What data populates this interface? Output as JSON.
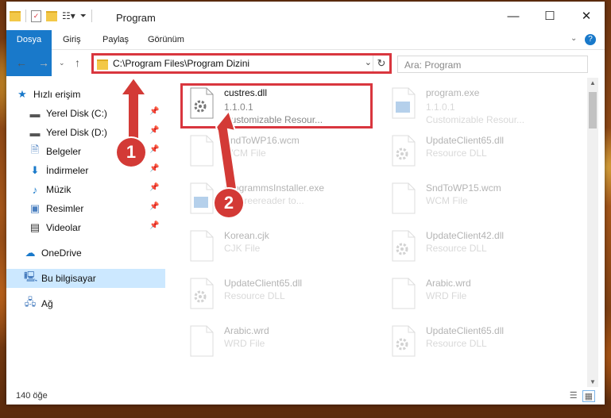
{
  "window": {
    "title": "Program",
    "min_icon": "minimize-icon",
    "max_icon": "maximize-icon",
    "close_icon": "close-icon"
  },
  "ribbon": {
    "tabs": [
      "Dosya",
      "Giriş",
      "Paylaş",
      "Görünüm"
    ],
    "accent": "#1979ca"
  },
  "address": {
    "path": "C:\\Program Files\\Program Dizini",
    "search_placeholder": "Ara: Program"
  },
  "nav": {
    "items": [
      {
        "label": "Hızlı erişim",
        "icon": "star-icon",
        "pinned": false
      },
      {
        "label": "Yerel Disk (C:)",
        "icon": "drive-icon",
        "pinned": true
      },
      {
        "label": "Yerel Disk (D:)",
        "icon": "drive-icon",
        "pinned": true
      },
      {
        "label": "Belgeler",
        "icon": "documents-icon",
        "pinned": true
      },
      {
        "label": "İndirmeler",
        "icon": "download-icon",
        "pinned": true
      },
      {
        "label": "Müzik",
        "icon": "music-icon",
        "pinned": true
      },
      {
        "label": "Resimler",
        "icon": "pictures-icon",
        "pinned": true
      },
      {
        "label": "Videolar",
        "icon": "video-icon",
        "pinned": true
      },
      {
        "label": "OneDrive",
        "icon": "cloud-icon",
        "pinned": false
      },
      {
        "label": "Bu bilgisayar",
        "icon": "computer-icon",
        "pinned": false
      },
      {
        "label": "Ağ",
        "icon": "network-icon",
        "pinned": false
      }
    ]
  },
  "files": [
    {
      "name": "custres.dll",
      "version": "1.1.0.1",
      "type": "Customizable Resour..."
    },
    {
      "name": "program.exe",
      "version": "1.1.0.1",
      "type": "Customizable Resour..."
    },
    {
      "name": "SndToWP16.wcm",
      "version": "",
      "type": "WCM File"
    },
    {
      "name": "UpdateClient65.dll",
      "version": "",
      "type": "Resource DLL"
    },
    {
      "name": "ProgrammsInstaller.exe",
      "version": "",
      "type": "FF Freereader to..."
    },
    {
      "name": "SndToWP15.wcm",
      "version": "",
      "type": "WCM File"
    },
    {
      "name": "Korean.cjk",
      "version": "",
      "type": "CJK File"
    },
    {
      "name": "UpdateClient42.dll",
      "version": "",
      "type": "Resource DLL"
    },
    {
      "name": "UpdateClient65.dll",
      "version": "",
      "type": "Resource DLL"
    },
    {
      "name": "Arabic.wrd",
      "version": "",
      "type": "WRD File"
    },
    {
      "name": "Arabic.wrd",
      "version": "",
      "type": "WRD File"
    },
    {
      "name": "UpdateClient65.dll",
      "version": "",
      "type": "Resource DLL"
    }
  ],
  "status": {
    "count": "140 öğe"
  },
  "callouts": [
    "1",
    "2"
  ],
  "colors": {
    "highlight": "#d9363e",
    "callout": "#d33a36"
  }
}
